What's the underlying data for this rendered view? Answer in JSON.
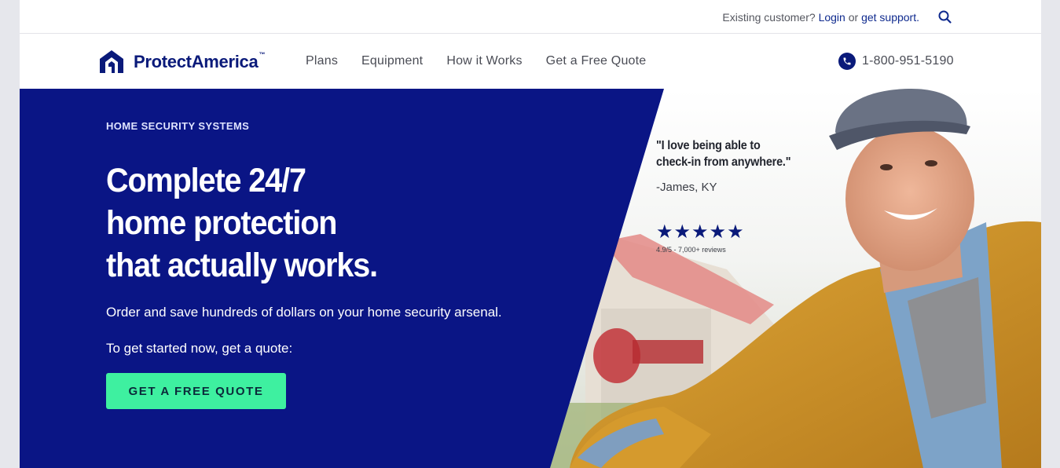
{
  "utility": {
    "existing_customer": "Existing customer?",
    "login_label": "Login",
    "or": "or",
    "support_label": "get support.",
    "search_icon": "search-icon"
  },
  "nav": {
    "logo_text": "ProtectAmerica",
    "logo_tm": "™",
    "links": [
      {
        "label": "Plans"
      },
      {
        "label": "Equipment"
      },
      {
        "label": "How it Works"
      },
      {
        "label": "Get a Free Quote"
      }
    ],
    "phone_icon": "phone-icon",
    "phone": "1-800-951-5190"
  },
  "hero": {
    "eyebrow": "HOME SECURITY SYSTEMS",
    "headline": [
      "Complete 24/7",
      "home protection",
      "that actually works."
    ],
    "subtext": "Order and save hundreds of dollars on your home security arsenal.",
    "prompt": "To get started now, get a quote:",
    "cta_label": "GET A FREE QUOTE",
    "testimonial": {
      "quote_lines": [
        "\"I love being able to",
        "check-in from anywhere.\""
      ],
      "attribution": "-James, KY",
      "rating_stars": 5,
      "reviews": "4.9/5 - 7,000+ reviews"
    }
  },
  "colors": {
    "brand_navy": "#0a1585",
    "cta_green": "#3ef0a0",
    "link_blue": "#0f2a8e"
  }
}
